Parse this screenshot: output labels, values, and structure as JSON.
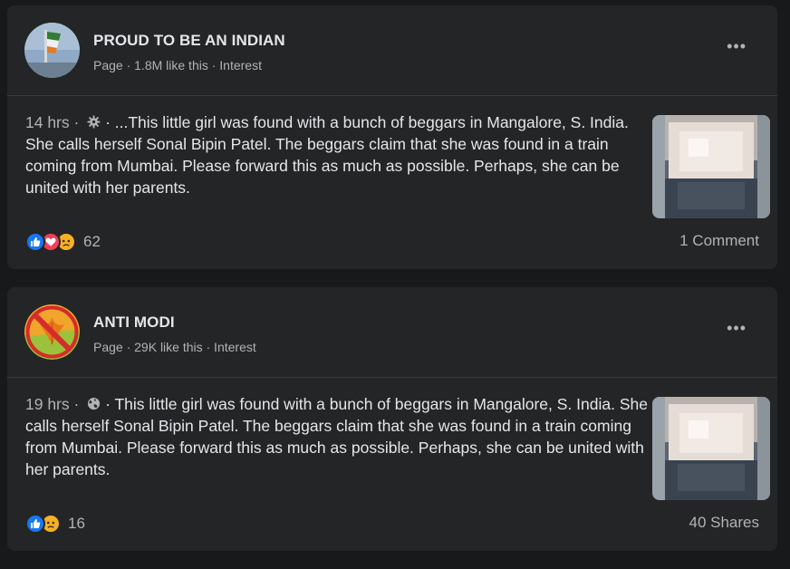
{
  "posts": [
    {
      "page_name": "PROUD TO BE AN INDIAN",
      "page_meta": "Page · 1.8M like this · Interest",
      "timestamp": "14 hrs ·",
      "audience_icon": "gear-icon",
      "text": " · ...This little girl was found with a bunch of beggars in Mangalore, S. India. She calls herself Sonal Bipin Patel. The beggars claim that she was found in a train coming from Mumbai. Please forward this as much as possible. Perhaps, she can be united with her parents.",
      "reactions": [
        "like-icon",
        "love-icon",
        "sad-icon"
      ],
      "reaction_count": "62",
      "stat": "1 Comment"
    },
    {
      "page_name": "ANTI MODI",
      "page_meta": "Page · 29K like this · Interest",
      "timestamp": "19 hrs ·",
      "audience_icon": "globe-icon",
      "text": " · This little girl was found with a bunch of beggars in Mangalore, S. India. She calls herself Sonal Bipin Patel. The beggars claim that she was found in a train coming from Mumbai. Please forward this as much as possible. Perhaps, she can be united with her parents.",
      "reactions": [
        "like-icon",
        "sad-icon"
      ],
      "reaction_count": "16",
      "stat": "40 Shares"
    }
  ],
  "more_label": "•••",
  "colors": {
    "background": "#18191a",
    "card": "#242526",
    "text_primary": "#e4e6eb",
    "text_secondary": "#b0b3b8",
    "like_blue": "#1877f2",
    "love_pink": "#f33e58",
    "sad_yellow": "#f7b125"
  }
}
